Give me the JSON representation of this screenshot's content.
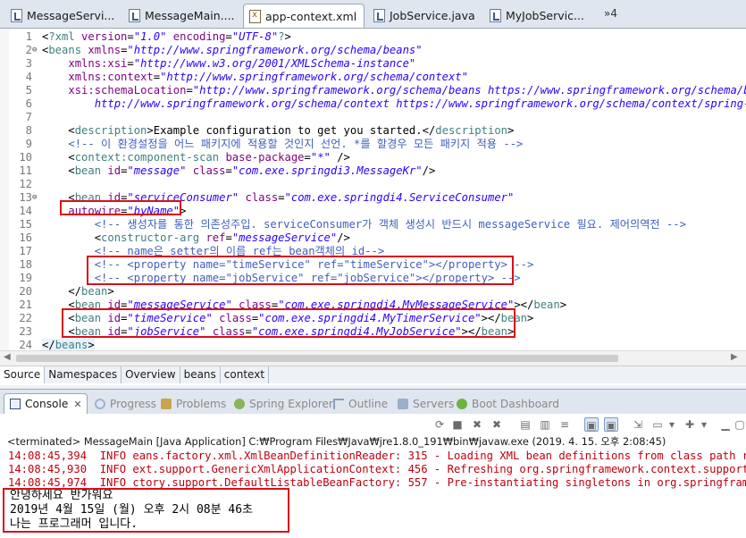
{
  "editor_tabs": [
    {
      "label": "MessageServi...",
      "icon": "java-file-icon",
      "closable": true,
      "active": false
    },
    {
      "label": "MessageMain....",
      "icon": "java-file-icon",
      "closable": false,
      "active": false
    },
    {
      "label": "app-context.xml",
      "icon": "xml-file-icon",
      "closable": true,
      "active": true
    },
    {
      "label": "JobService.java",
      "icon": "java-file-icon",
      "closable": false,
      "active": false
    },
    {
      "label": "MyJobServic...",
      "icon": "java-file-icon",
      "closable": false,
      "active": false
    }
  ],
  "editor_tabs_overflow": "»4",
  "lines": [
    {
      "n": "1",
      "fold": "",
      "segs": [
        [
          "tx",
          "<"
        ],
        [
          "kw",
          "?xml "
        ],
        [
          "at",
          "version"
        ],
        [
          "tx",
          "="
        ],
        [
          "val",
          "\"1.0\""
        ],
        [
          "tx",
          " "
        ],
        [
          "at",
          "encoding"
        ],
        [
          "tx",
          "="
        ],
        [
          "val",
          "\"UTF-8\""
        ],
        [
          "kw",
          "?"
        ],
        [
          "tx",
          ">"
        ]
      ]
    },
    {
      "n": "2",
      "fold": "⊖",
      "segs": [
        [
          "tx",
          "<"
        ],
        [
          "kw",
          "beans "
        ],
        [
          "at",
          "xmlns"
        ],
        [
          "tx",
          "="
        ],
        [
          "val",
          "\"http://www.springframework.org/schema/beans\""
        ]
      ]
    },
    {
      "n": "3",
      "fold": "",
      "segs": [
        [
          "tx",
          "    "
        ],
        [
          "at",
          "xmlns:xsi"
        ],
        [
          "tx",
          "="
        ],
        [
          "val",
          "\"http://www.w3.org/2001/XMLSchema-instance\""
        ]
      ]
    },
    {
      "n": "4",
      "fold": "",
      "segs": [
        [
          "tx",
          "    "
        ],
        [
          "at",
          "xmlns:context"
        ],
        [
          "tx",
          "="
        ],
        [
          "val",
          "\"http://www.springframework.org/schema/context\""
        ]
      ]
    },
    {
      "n": "5",
      "fold": "",
      "segs": [
        [
          "tx",
          "    "
        ],
        [
          "at",
          "xsi:schemaLocation"
        ],
        [
          "tx",
          "="
        ],
        [
          "val",
          "\"http://www.springframework.org/schema/beans https://www.springframework.org/schema/beans"
        ]
      ]
    },
    {
      "n": "6",
      "fold": "",
      "segs": [
        [
          "val",
          "        http://www.springframework.org/schema/context https://www.springframework.org/schema/context/spring-cont"
        ]
      ]
    },
    {
      "n": "7",
      "fold": "",
      "segs": []
    },
    {
      "n": "8",
      "fold": "",
      "segs": [
        [
          "tx",
          "    <"
        ],
        [
          "kw",
          "description"
        ],
        [
          "tx",
          ">"
        ],
        [
          "tx",
          "Example configuration to get you started."
        ],
        [
          "tx",
          "</"
        ],
        [
          "kw",
          "description"
        ],
        [
          "tx",
          ">"
        ]
      ]
    },
    {
      "n": "9",
      "fold": "",
      "segs": [
        [
          "tx",
          "    "
        ],
        [
          "cm",
          "<!-- 이 환경설정을 어느 패키지에 적용할 것인지 선언. *를 할경우 모든 패키지 적용 -->"
        ]
      ]
    },
    {
      "n": "10",
      "fold": "",
      "segs": [
        [
          "tx",
          "    <"
        ],
        [
          "kw",
          "context:component-scan "
        ],
        [
          "at",
          "base-package"
        ],
        [
          "tx",
          "="
        ],
        [
          "val",
          "\"*\""
        ],
        [
          "tx",
          " />"
        ]
      ]
    },
    {
      "n": "11",
      "fold": "",
      "segs": [
        [
          "tx",
          "    <"
        ],
        [
          "kw",
          "bean "
        ],
        [
          "at",
          "id"
        ],
        [
          "tx",
          "="
        ],
        [
          "val",
          "\"message\""
        ],
        [
          "tx",
          " "
        ],
        [
          "at",
          "class"
        ],
        [
          "tx",
          "="
        ],
        [
          "val",
          "\"com.exe.springdi3.MessageKr\""
        ],
        [
          "tx",
          "/>"
        ]
      ]
    },
    {
      "n": "12",
      "fold": "",
      "segs": []
    },
    {
      "n": "13",
      "fold": "⊖",
      "segs": [
        [
          "tx",
          "    <"
        ],
        [
          "kw",
          "bean "
        ],
        [
          "at",
          "id"
        ],
        [
          "tx",
          "="
        ],
        [
          "val",
          "\"serviceConsumer\""
        ],
        [
          "tx",
          " "
        ],
        [
          "at",
          "class"
        ],
        [
          "tx",
          "="
        ],
        [
          "val",
          "\"com.exe.springdi4.ServiceConsumer\""
        ]
      ]
    },
    {
      "n": "14",
      "fold": "",
      "segs": [
        [
          "tx",
          "    "
        ],
        [
          "at",
          "autowire"
        ],
        [
          "tx",
          "="
        ],
        [
          "val",
          "\"byName\""
        ],
        [
          "tx",
          ">"
        ]
      ]
    },
    {
      "n": "15",
      "fold": "",
      "segs": [
        [
          "tx",
          "        "
        ],
        [
          "cm",
          "<!-- 생성자를 통한 의존성주입. serviceConsumer가 객체 생성시 반드시 messageService 필요. 제어의역전 -->"
        ]
      ]
    },
    {
      "n": "16",
      "fold": "",
      "segs": [
        [
          "tx",
          "        <"
        ],
        [
          "kw",
          "constructor-arg "
        ],
        [
          "at",
          "ref"
        ],
        [
          "tx",
          "="
        ],
        [
          "val",
          "\"messageService\""
        ],
        [
          "tx",
          "/>"
        ]
      ]
    },
    {
      "n": "17",
      "fold": "",
      "segs": [
        [
          "tx",
          "        "
        ],
        [
          "cm",
          "<!-- name은 setter의 이름 ref는 bean객체의 id-->"
        ]
      ]
    },
    {
      "n": "18",
      "fold": "",
      "segs": [
        [
          "tx",
          "        "
        ],
        [
          "cm",
          "<!-- <property name=\"timeService\" ref=\"timeService\"></property> -->"
        ]
      ]
    },
    {
      "n": "19",
      "fold": "",
      "segs": [
        [
          "tx",
          "        "
        ],
        [
          "cm",
          "<!-- <property name=\"jobService\" ref=\"jobService\"></property> -->"
        ]
      ]
    },
    {
      "n": "20",
      "fold": "",
      "segs": [
        [
          "tx",
          "    </"
        ],
        [
          "kw",
          "bean"
        ],
        [
          "tx",
          ">"
        ]
      ]
    },
    {
      "n": "21",
      "fold": "",
      "segs": [
        [
          "tx",
          "    <"
        ],
        [
          "kw",
          "bean "
        ],
        [
          "at",
          "id"
        ],
        [
          "tx",
          "="
        ],
        [
          "val",
          "\"messageService\""
        ],
        [
          "tx",
          " "
        ],
        [
          "at",
          "class"
        ],
        [
          "tx",
          "="
        ],
        [
          "val",
          "\"com.exe.springdi4.MyMessageService\""
        ],
        [
          "tx",
          "></"
        ],
        [
          "kw",
          "bean"
        ],
        [
          "tx",
          ">"
        ]
      ]
    },
    {
      "n": "22",
      "fold": "",
      "segs": [
        [
          "tx",
          "    <"
        ],
        [
          "kw",
          "bean "
        ],
        [
          "at",
          "id"
        ],
        [
          "tx",
          "="
        ],
        [
          "val",
          "\"timeService\""
        ],
        [
          "tx",
          " "
        ],
        [
          "at",
          "class"
        ],
        [
          "tx",
          "="
        ],
        [
          "val",
          "\"com.exe.springdi4.MyTimerService\""
        ],
        [
          "tx",
          "></"
        ],
        [
          "kw",
          "bean"
        ],
        [
          "tx",
          ">"
        ]
      ]
    },
    {
      "n": "23",
      "fold": "",
      "segs": [
        [
          "tx",
          "    <"
        ],
        [
          "kw",
          "bean "
        ],
        [
          "at",
          "id"
        ],
        [
          "tx",
          "="
        ],
        [
          "val",
          "\"jobService\""
        ],
        [
          "tx",
          " "
        ],
        [
          "at",
          "class"
        ],
        [
          "tx",
          "="
        ],
        [
          "val",
          "\"com.exe.springdi4.MyJobService\""
        ],
        [
          "tx",
          "></"
        ],
        [
          "kw",
          "bean"
        ],
        [
          "tx",
          ">"
        ]
      ]
    },
    {
      "n": "24",
      "fold": "",
      "segs": [
        [
          "tx",
          "</"
        ],
        [
          "kw",
          "beans"
        ],
        [
          "tx",
          ">"
        ]
      ]
    }
  ],
  "editor_bottom_tabs": [
    "Source",
    "Namespaces",
    "Overview",
    "beans",
    "context"
  ],
  "view_tabs": [
    {
      "label": "Console",
      "icon": "console-icon",
      "active": true
    },
    {
      "label": "Progress",
      "icon": "progress-icon",
      "active": false
    },
    {
      "label": "Problems",
      "icon": "problems-icon",
      "active": false
    },
    {
      "label": "Spring Explorer",
      "icon": "spring-explorer-icon",
      "active": false
    },
    {
      "label": "Outline",
      "icon": "outline-icon",
      "active": false
    },
    {
      "label": "Servers",
      "icon": "servers-icon",
      "active": false
    },
    {
      "label": "Boot Dashboard",
      "icon": "boot-dashboard-icon",
      "active": false
    }
  ],
  "console": {
    "terminated": "<terminated> MessageMain [Java Application] C:₩Program Files₩Java₩jre1.8.0_191₩bin₩javaw.exe (2019. 4. 15. 오후 2:08:45)",
    "log_lines": [
      "14:08:45,394  INFO eans.factory.xml.XmlBeanDefinitionReader: 315 - Loading XML bean definitions from class path resour",
      "14:08:45,930  INFO ext.support.GenericXmlApplicationContext: 456 - Refreshing org.springframework.context.support.Gene",
      "14:08:45,974  INFO ctory.support.DefaultListableBeanFactory: 557 - Pre-instantiating singletons in org.springframework"
    ],
    "output_lines": [
      "안녕하세요 반가워요",
      "2019년 4월 15일 (월) 오후 2시 08분 46초",
      "나는 프로그래머 입니다."
    ]
  },
  "colors": {
    "highlight_box": "#d8101a",
    "log_text": "#c0000f"
  }
}
